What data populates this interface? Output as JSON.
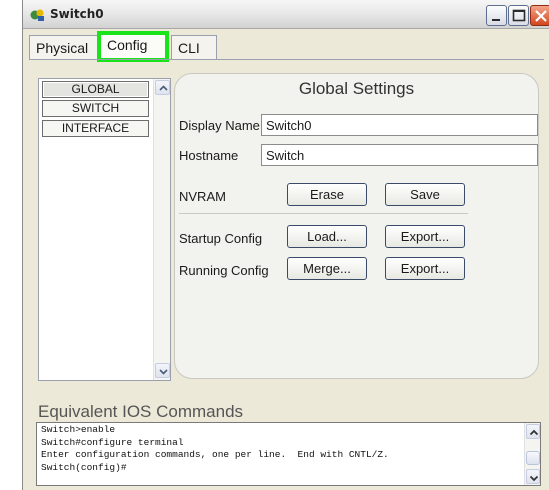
{
  "window": {
    "title": "Switch0",
    "icon": "switch-device-icon",
    "controls": {
      "minimize": "minimize-icon",
      "maximize": "maximize-icon",
      "close": "close-icon"
    }
  },
  "tabs": [
    {
      "label": "Physical",
      "selected": false
    },
    {
      "label": "Config",
      "selected": true,
      "highlight_color": "#19e319"
    },
    {
      "label": "CLI",
      "selected": false
    }
  ],
  "nav": {
    "items": [
      {
        "label": "GLOBAL",
        "active": true
      },
      {
        "label": "SWITCH",
        "active": false
      },
      {
        "label": "INTERFACE",
        "active": false
      }
    ]
  },
  "settings": {
    "title": "Global Settings",
    "display_name_label": "Display Name",
    "display_name_value": "Switch0",
    "hostname_label": "Hostname",
    "hostname_value": "Switch",
    "nvram_label": "NVRAM",
    "nvram_erase": "Erase",
    "nvram_save": "Save",
    "startup_label": "Startup Config",
    "startup_load": "Load...",
    "startup_export": "Export...",
    "running_label": "Running Config",
    "running_merge": "Merge...",
    "running_export": "Export..."
  },
  "ios": {
    "title": "Equivalent IOS Commands",
    "lines": [
      "Switch>enable",
      "Switch#configure terminal",
      "Enter configuration commands, one per line.  End with CNTL/Z.",
      "Switch(config)#"
    ]
  }
}
